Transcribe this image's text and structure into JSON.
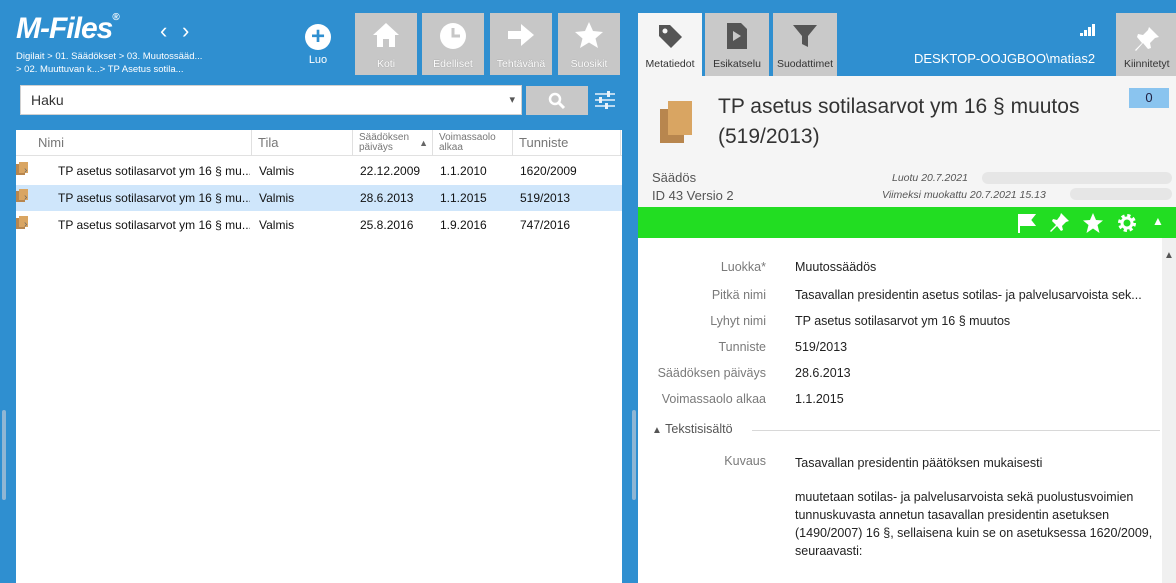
{
  "app": {
    "logo": "M-Files",
    "breadcrumb": [
      "Digilait > 01. Säädökset > 03. Muutossääd...",
      "> 02. Muuttuvan k...> TP Asetus sotila..."
    ]
  },
  "toolbar": {
    "create_label": "Luo",
    "tools": [
      {
        "label": "Koti",
        "icon": "home-icon"
      },
      {
        "label": "Edelliset",
        "icon": "clock-icon"
      },
      {
        "label": "Tehtävänä",
        "icon": "arrow-right-icon"
      },
      {
        "label": "Suosikit",
        "icon": "star-icon"
      }
    ]
  },
  "search": {
    "value": "Haku"
  },
  "list": {
    "columns": {
      "name": "Nimi",
      "state": "Tila",
      "date_l1": "Säädöksen",
      "date_l2": "päiväys",
      "valid_l1": "Voimassaolo",
      "valid_l2": "alkaa",
      "id": "Tunniste"
    },
    "rows": [
      {
        "name": "TP asetus sotilasarvot ym 16 § mu...",
        "state": "Valmis",
        "date": "22.12.2009",
        "valid": "1.1.2010",
        "id": "1620/2009",
        "selected": false
      },
      {
        "name": "TP asetus sotilasarvot ym 16 § mu...",
        "state": "Valmis",
        "date": "28.6.2013",
        "valid": "1.1.2015",
        "id": "519/2013",
        "selected": true
      },
      {
        "name": "TP asetus sotilasarvot ym 16 § mu...",
        "state": "Valmis",
        "date": "25.8.2016",
        "valid": "1.9.2016",
        "id": "747/2016",
        "selected": false
      }
    ]
  },
  "right_tabs": [
    {
      "label": "Metatiedot",
      "icon": "tag-icon",
      "active": true
    },
    {
      "label": "Esikatselu",
      "icon": "preview-icon",
      "active": false
    },
    {
      "label": "Suodattimet",
      "icon": "funnel-icon",
      "active": false
    }
  ],
  "pinned_label": "Kiinnitetyt",
  "user": "DESKTOP-OOJGBOO\\matias2",
  "object": {
    "title": "TP asetus sotilasarvot ym 16 § muutos (519/2013)",
    "comments": "0",
    "class": "Säädös",
    "id_version": "ID 43  Versio 2",
    "created": "Luotu 20.7.2021",
    "modified": "Viimeksi muokattu 20.7.2021 15.13"
  },
  "properties": [
    {
      "label": "Luokka*",
      "value": "Muutossäädös"
    },
    {
      "label": "Pitkä nimi",
      "value": "Tasavallan presidentin asetus sotilas- ja palvelusarvoista sek..."
    },
    {
      "label": "Lyhyt nimi",
      "value": "TP asetus sotilasarvot ym 16 § muutos"
    },
    {
      "label": "Tunniste",
      "value": "519/2013"
    },
    {
      "label": "Säädöksen päiväys",
      "value": "28.6.2013"
    },
    {
      "label": "Voimassaolo alkaa",
      "value": "1.1.2015"
    }
  ],
  "text_section": {
    "title": "Tekstisisältö",
    "desc_label": "Kuvaus",
    "desc_p1": "Tasavallan presidentin päätöksen mukaisesti",
    "desc_p2": "muutetaan sotilas- ja palvelusarvoista sekä puolustusvoimien tunnuskuvasta annetun tasavallan presidentin asetuksen (1490/2007) 16 §, sellaisena kuin se on asetuksessa 1620/2009, seuraavasti:"
  },
  "colors": {
    "brand": "#2f8fd0",
    "action_bar": "#22dd22",
    "selected_row": "#cfe6fb"
  }
}
